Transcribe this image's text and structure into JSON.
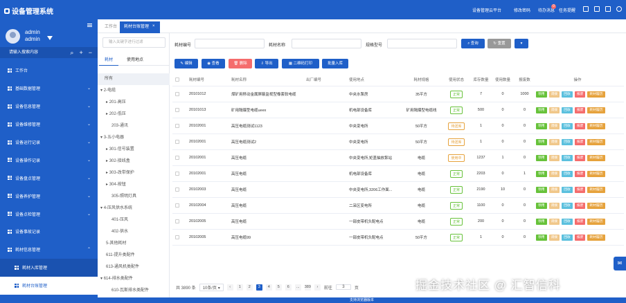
{
  "app": {
    "title": "设备管理系统"
  },
  "topnav": {
    "items": [
      "设备管理云平台",
      "修改密码",
      "待办消息",
      "任务提醒"
    ],
    "badge": "0"
  },
  "user": {
    "name": "admin",
    "role": "admin",
    "search_placeholder": "请输入搜索内容"
  },
  "sidebar": {
    "items": [
      {
        "label": "工作台"
      },
      {
        "label": "基础数据管理"
      },
      {
        "label": "设备信息管理"
      },
      {
        "label": "设备维修管理"
      },
      {
        "label": "设备运行记录"
      },
      {
        "label": "设备操作记录"
      },
      {
        "label": "设备盘点管理"
      },
      {
        "label": "设备养护管理"
      },
      {
        "label": "设备点检管理"
      },
      {
        "label": "设备事故记录"
      },
      {
        "label": "耗材信息管理"
      }
    ],
    "subitems": [
      {
        "label": "耗材入库管理"
      },
      {
        "label": "耗材台账管理"
      }
    ]
  },
  "tabs": [
    {
      "label": "工作台"
    },
    {
      "label": "耗材台账管理"
    }
  ],
  "tree_panel": {
    "search_placeholder": "输入关键字进行过滤",
    "tabs": [
      "耗材",
      "使用地点"
    ],
    "nodes": [
      "所有",
      "2-电缆",
      "201-高压",
      "202-低压",
      "203-通讯",
      "3-五小电器",
      "301-信号装置",
      "302-接线盒",
      "303-改带保护",
      "304-按钮",
      "305-照明灯具",
      "4-压风供水系统",
      "401-压风",
      "402-供水",
      "5-其他耗材",
      "611-提升类配件",
      "613-通风机类配件",
      "614-排水类配件",
      "610-瓦斯排水类配件"
    ]
  },
  "filters": {
    "code_label": "耗材编号",
    "name_label": "耗材名称",
    "spec_label": "规格型号",
    "search_btn": "查询",
    "reset_btn": "重置"
  },
  "toolbar": {
    "edit": "编辑",
    "view": "查看",
    "delete": "删除",
    "export": "导出",
    "qr": "二维码打印",
    "batch": "批量入库"
  },
  "table": {
    "headers": [
      "耗材编号",
      "耗材名称",
      "出厂编号",
      "使用地点",
      "耗材规格",
      "使用状态",
      "库存数量",
      "使用数量",
      "报废数",
      "操作"
    ],
    "rows": [
      {
        "code": "20101012",
        "name": "煤矿用移动金属屏蔽监视型橡套软电缆",
        "factory": "",
        "place": "中央水泵房",
        "spec": "35平方",
        "status": "正常",
        "stock": "7",
        "used": "0",
        "scrap": "1000"
      },
      {
        "code": "20101013",
        "name": "矿用隔爆型电缆ueex",
        "factory": "",
        "place": "机电部设备库",
        "spec": "矿用隔爆型电缆线",
        "status": "正常",
        "stock": "500",
        "used": "0",
        "scrap": "0"
      },
      {
        "code": "20102001",
        "name": "高压电缆测试1123",
        "factory": "",
        "place": "中央变电所",
        "spec": "50平方",
        "status": "待送库",
        "stock": "1",
        "used": "0",
        "scrap": "0"
      },
      {
        "code": "20102001",
        "name": "高压电缆测试2",
        "factory": "",
        "place": "中央变电所",
        "spec": "50平方",
        "status": "待送库",
        "stock": "1",
        "used": "0",
        "scrap": "0"
      },
      {
        "code": "20102001",
        "name": "高压电缆",
        "factory": "",
        "place": "中央变电所,矩盖抽放泵站",
        "spec": "电缆",
        "status": "使用中",
        "stock": "1237",
        "used": "1",
        "scrap": "0"
      },
      {
        "code": "20102001",
        "name": "高压电缆",
        "factory": "",
        "place": "机电部设备库",
        "spec": "电缆",
        "status": "正常",
        "stock": "2203",
        "used": "0",
        "scrap": "1"
      },
      {
        "code": "20102003",
        "name": "高压电缆",
        "factory": "",
        "place": "中央变电所,3206工作面...",
        "spec": "电缆",
        "status": "正常",
        "stock": "2190",
        "used": "10",
        "scrap": "0"
      },
      {
        "code": "20102004",
        "name": "高压电缆",
        "factory": "",
        "place": "二采区变电所",
        "spec": "电缆",
        "status": "正常",
        "stock": "1100",
        "used": "0",
        "scrap": "0"
      },
      {
        "code": "20102005",
        "name": "高压电缆",
        "factory": "",
        "place": "一部皮带机头配电点",
        "spec": "电缆",
        "status": "正常",
        "stock": "200",
        "used": "0",
        "scrap": "0"
      },
      {
        "code": "20102005",
        "name": "高压电缆99",
        "factory": "",
        "place": "一部皮带机头配电点",
        "spec": "50平方",
        "status": "正常",
        "stock": "1",
        "used": "0",
        "scrap": "0"
      }
    ],
    "ops": [
      "领用",
      "调拨",
      "回收",
      "报废",
      "耗材履历"
    ]
  },
  "pagination": {
    "total": "共 3890 条",
    "size": "10条/页",
    "pages": [
      "1",
      "2",
      "3",
      "4",
      "5",
      "6",
      "...",
      "389"
    ],
    "goto": "前往",
    "page_input": "3",
    "page_suffix": "页"
  },
  "footer": {
    "text": "支持浏览器版本"
  },
  "watermark": {
    "text": "掘金技术社区 @ 汇智信科"
  },
  "colors": {
    "primary": "#1f5fc8",
    "success": "#67c23a",
    "warning": "#e6a23c",
    "danger": "#f56c6c",
    "info": "#5bc0de"
  }
}
